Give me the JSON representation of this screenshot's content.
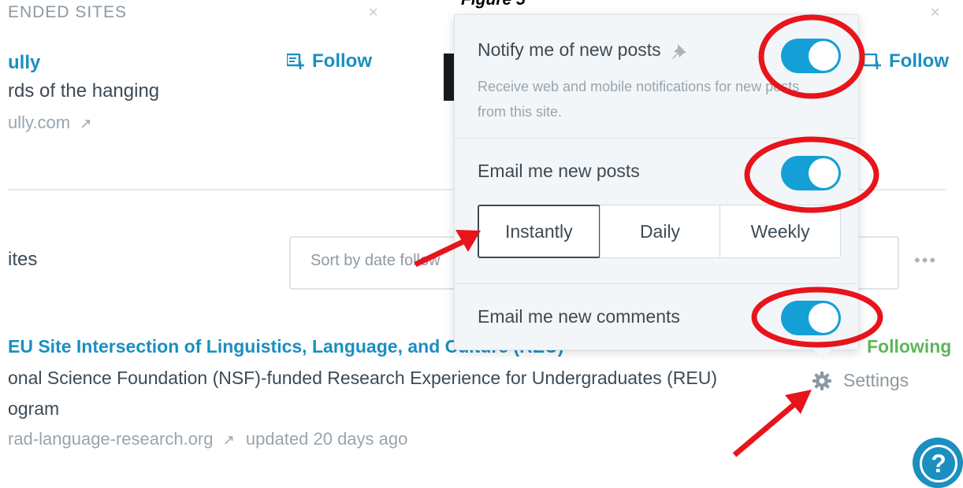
{
  "caption": "Figure 5",
  "recommended": {
    "heading": "ENDED SITES",
    "site_name": "ully",
    "site_desc": "rds of the hanging",
    "site_url": "ully.com",
    "follow_label": "Follow"
  },
  "sites_section": {
    "title": "ites",
    "sort_placeholder": "Sort by date follow",
    "more": "•••"
  },
  "reu": {
    "title": "EU Site Intersection of Linguistics, Language, and Culture (REU)",
    "following": "Following",
    "desc": "onal Science Foundation (NSF)-funded Research Experience for Undergraduates (REU)",
    "desc2": "ogram",
    "url": "rad-language-research.org",
    "updated": "updated 20 days ago",
    "settings": "Settings"
  },
  "popover": {
    "notify_label": "Notify me of new posts",
    "notify_sub": "Receive web and mobile notifications for new posts from this site.",
    "notify_on": true,
    "email_posts_label": "Email me new posts",
    "email_posts_on": true,
    "frequency_options": [
      "Instantly",
      "Daily",
      "Weekly"
    ],
    "frequency_selected": "Instantly",
    "email_comments_label": "Email me new comments",
    "email_comments_on": true
  },
  "help_label": "?",
  "colors": {
    "accent": "#14a0d6",
    "link": "#1a8fc0",
    "following": "#5fb55a",
    "annotation": "#e8141b"
  }
}
